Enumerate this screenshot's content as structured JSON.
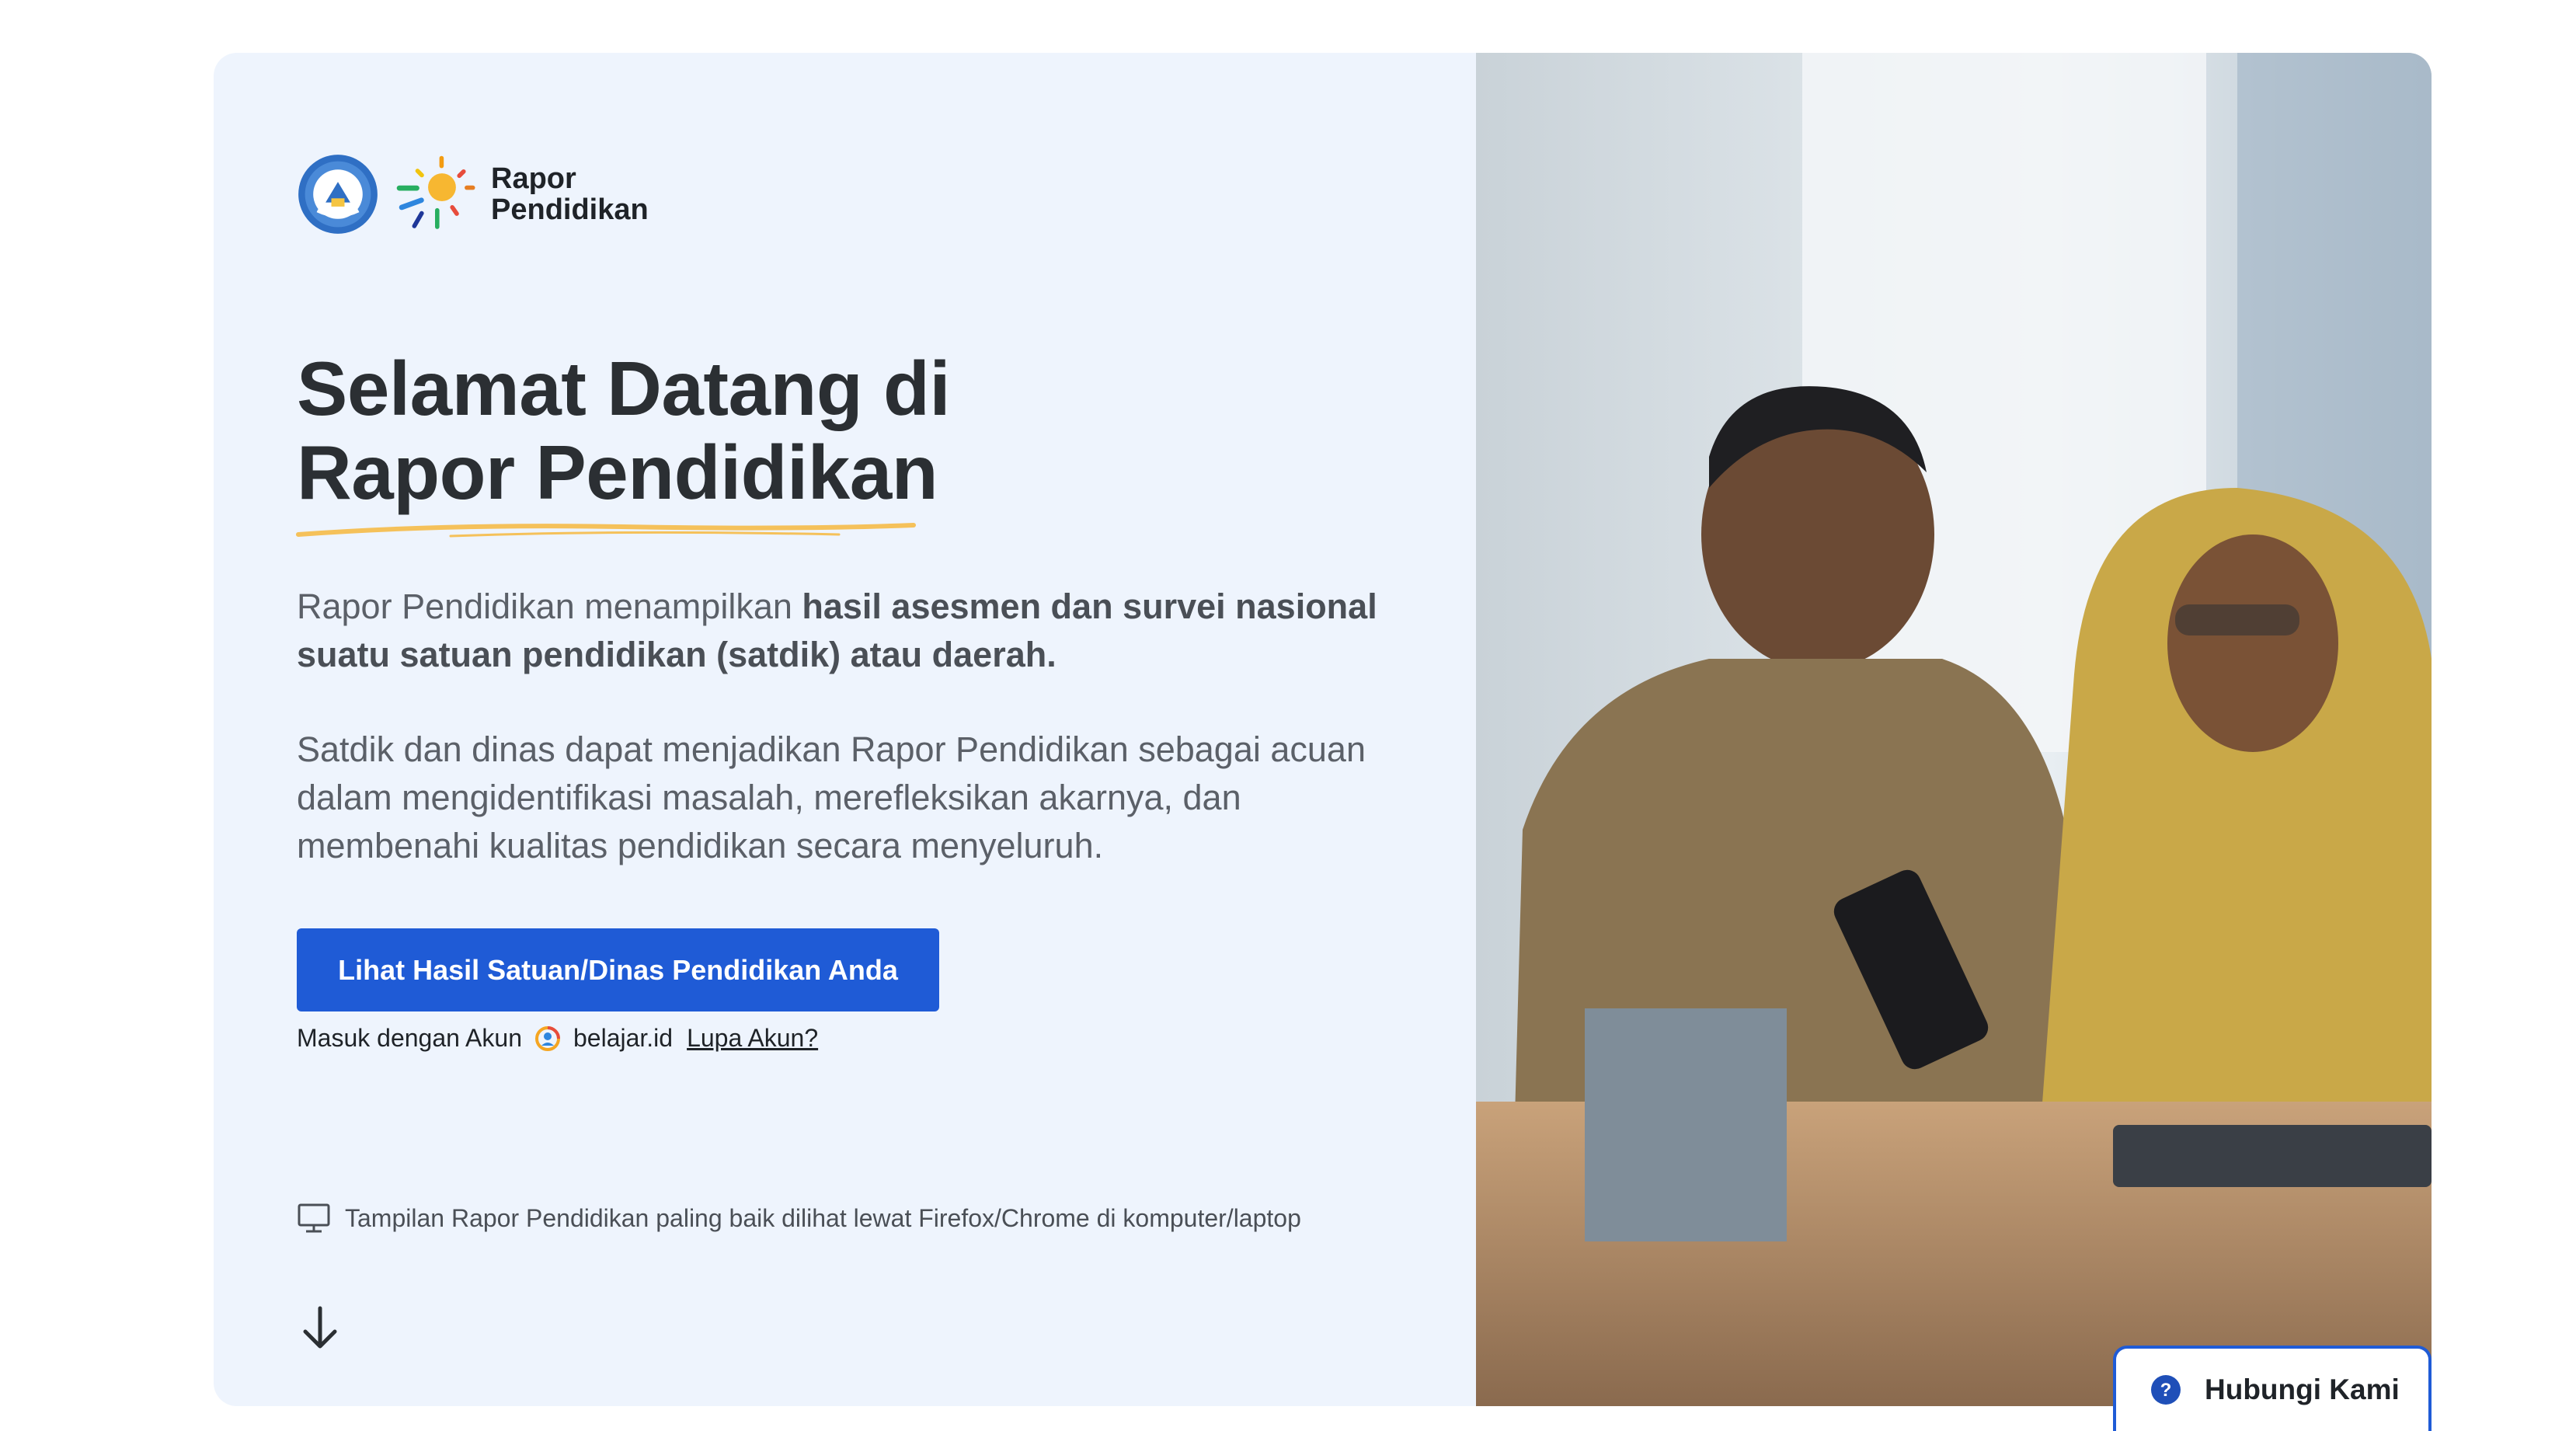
{
  "brand": {
    "line1": "Rapor",
    "line2": "Pendidikan"
  },
  "headline": {
    "line1": "Selamat Datang di",
    "line2": "Rapor Pendidikan"
  },
  "description": {
    "part1": "Rapor Pendidikan menampilkan ",
    "bold": "hasil asesmen dan survei nasional suatu satuan pendidikan (satdik) atau daerah.",
    "paragraph2": "Satdik dan dinas dapat menjadikan Rapor Pendidikan sebagai acuan dalam mengidentifikasi masalah, merefleksikan akarnya, dan membenahi kualitas pendidikan secara menyeluruh."
  },
  "cta": {
    "label": "Lihat Hasil Satuan/Dinas Pendidikan Anda"
  },
  "login": {
    "prefix": "Masuk dengan Akun",
    "account": "belajar.id",
    "forgot": "Lupa Akun?"
  },
  "tip": {
    "text": "Tampilan Rapor Pendidikan paling baik dilihat lewat Firefox/Chrome di komputer/laptop"
  },
  "contact": {
    "label": "Hubungi Kami"
  },
  "colors": {
    "primary": "#1f5bd6",
    "card_bg": "#eef4fd",
    "underline": "#f5c15a"
  }
}
